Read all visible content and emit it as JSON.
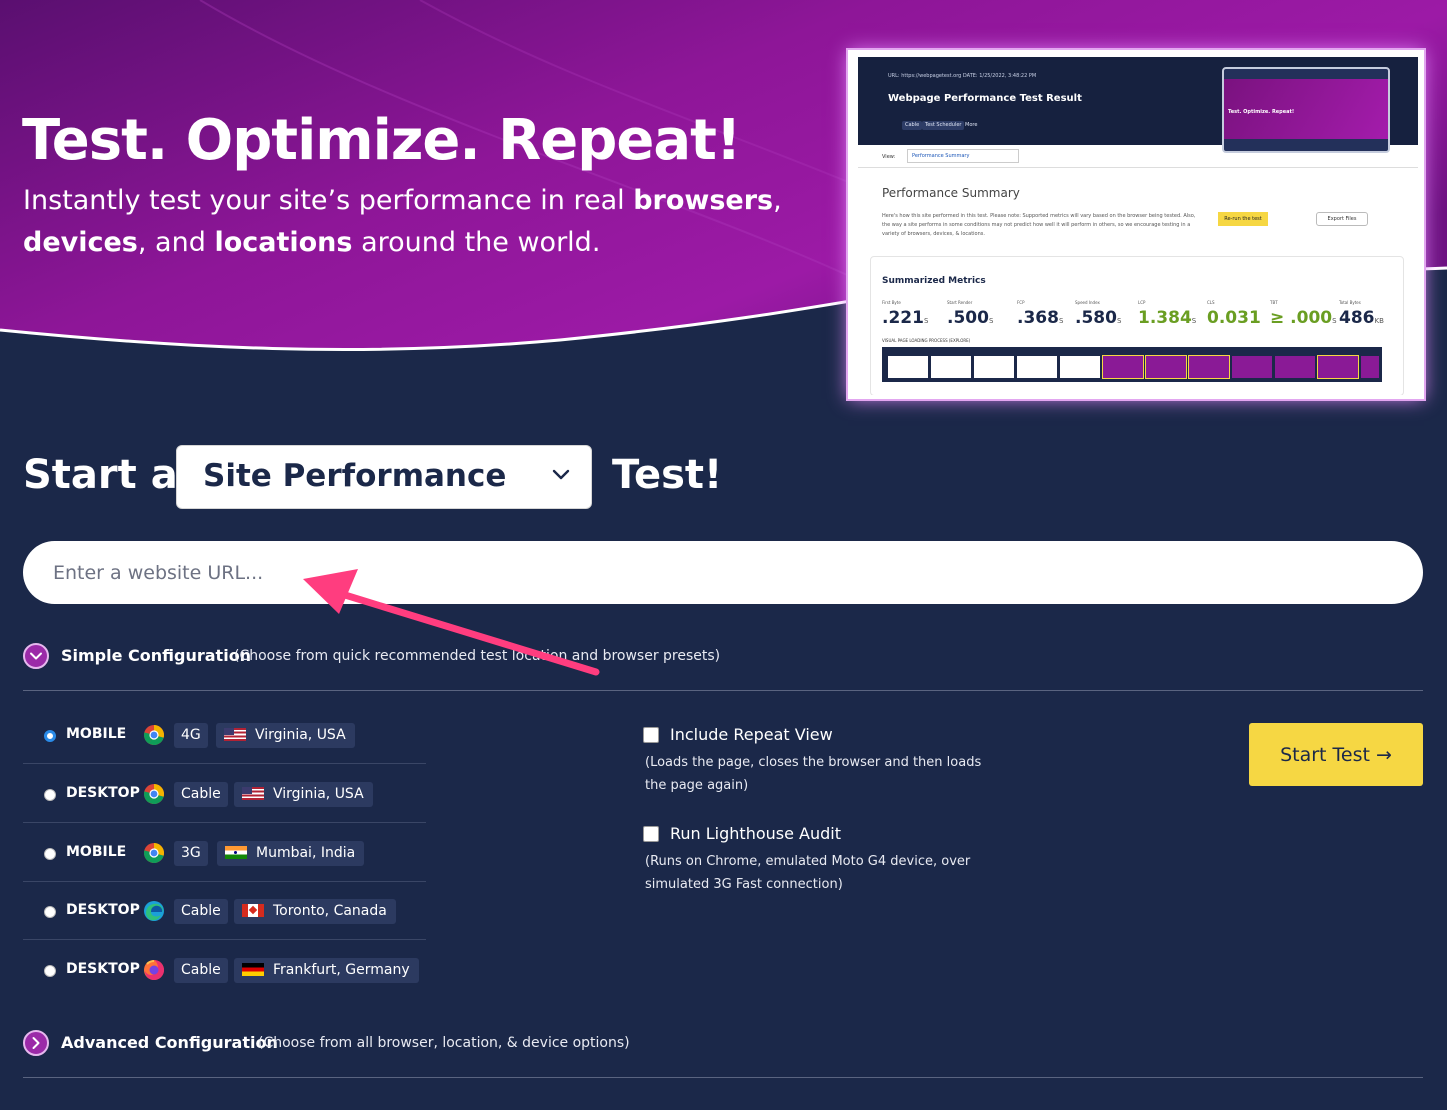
{
  "hero": {
    "title": "Test. Optimize. Repeat!",
    "subtitle_1": "Instantly test your site’s performance in real ",
    "subtitle_b1": "browsers",
    "subtitle_2": ",",
    "subtitle_b2": "devices",
    "subtitle_3": ", and ",
    "subtitle_b3": "locations",
    "subtitle_4": " around the world."
  },
  "preview": {
    "meta": "URL: https://webpagetest.org     DATE: 1/25/2022, 3:48:22 PM",
    "title": "Webpage Performance Test Result",
    "chips": [
      "Cable",
      "Test Scheduler",
      "More"
    ],
    "mini_title": "Test. Optimize. Repeat!",
    "view_label": "View:",
    "view_value": "Performance Summary",
    "summary_title": "Performance Summary",
    "summary_desc": "Here's how this site performed in this test. Please note: Supported metrics will vary based on the browser being tested. Also, the way a site performs in some conditions may not predict how well it will perform in others, so we encourage testing in a variety of browsers, devices, & locations.",
    "rerun_label": "Re-run the test",
    "export_label": "Export Files",
    "summarized_title": "Summarized Metrics",
    "metrics": [
      {
        "label": "First Byte",
        "value": ".221",
        "unit": "S",
        "good": false
      },
      {
        "label": "Start Render",
        "value": ".500",
        "unit": "S",
        "good": false
      },
      {
        "label": "FCP",
        "value": ".368",
        "unit": "S",
        "good": false
      },
      {
        "label": "Speed Index",
        "value": ".580",
        "unit": "S",
        "good": false
      },
      {
        "label": "LCP",
        "value": "1.384",
        "unit": "S",
        "good": true
      },
      {
        "label": "CLS",
        "value": "0.031",
        "unit": "",
        "good": true
      },
      {
        "label": "TBT",
        "value": "≥ .000",
        "unit": "S",
        "good": true
      },
      {
        "label": "Total Bytes",
        "value": "486",
        "unit": "KB",
        "good": false
      }
    ],
    "visual_label": "VISUAL PAGE LOADING PROCESS (EXPLORE)"
  },
  "test_selector": {
    "prefix": "Start a",
    "selected": "Site Performance",
    "suffix": "Test!"
  },
  "url_input": {
    "placeholder": "Enter a website URL...",
    "value": ""
  },
  "simple_config": {
    "title": "Simple Configuration",
    "description": "(Choose from quick recommended test location and browser presets)"
  },
  "presets": [
    {
      "device": "MOBILE",
      "browser": "chrome-icon",
      "connection": "4G",
      "flag": "us-flag-icon",
      "location": "Virginia, USA",
      "checked": true
    },
    {
      "device": "DESKTOP",
      "browser": "chrome-icon",
      "connection": "Cable",
      "flag": "us-flag-icon",
      "location": "Virginia, USA",
      "checked": false
    },
    {
      "device": "MOBILE",
      "browser": "chrome-icon",
      "connection": "3G",
      "flag": "india-flag-icon",
      "location": "Mumbai, India",
      "checked": false
    },
    {
      "device": "DESKTOP",
      "browser": "edge-icon",
      "connection": "Cable",
      "flag": "canada-flag-icon",
      "location": "Toronto, Canada",
      "checked": false
    },
    {
      "device": "DESKTOP",
      "browser": "firefox-icon",
      "connection": "Cable",
      "flag": "germany-flag-icon",
      "location": "Frankfurt, Germany",
      "checked": false
    }
  ],
  "options": {
    "repeat_view": {
      "label": "Include Repeat View",
      "description": "(Loads the page, closes the browser and then loads the page again)",
      "checked": false
    },
    "lighthouse": {
      "label": "Run Lighthouse Audit",
      "description": "(Runs on Chrome, emulated Moto G4 device, over simulated 3G Fast connection)",
      "checked": false
    }
  },
  "start_button": "Start Test →",
  "advanced_config": {
    "title": "Advanced Configuration",
    "description": "(Choose from all browser, location, & device options)"
  },
  "colors": {
    "background": "#1b2849",
    "hero_purple": "#8a1a96",
    "accent_yellow": "#f6d743",
    "arrow_pink": "#ff3d7f"
  }
}
